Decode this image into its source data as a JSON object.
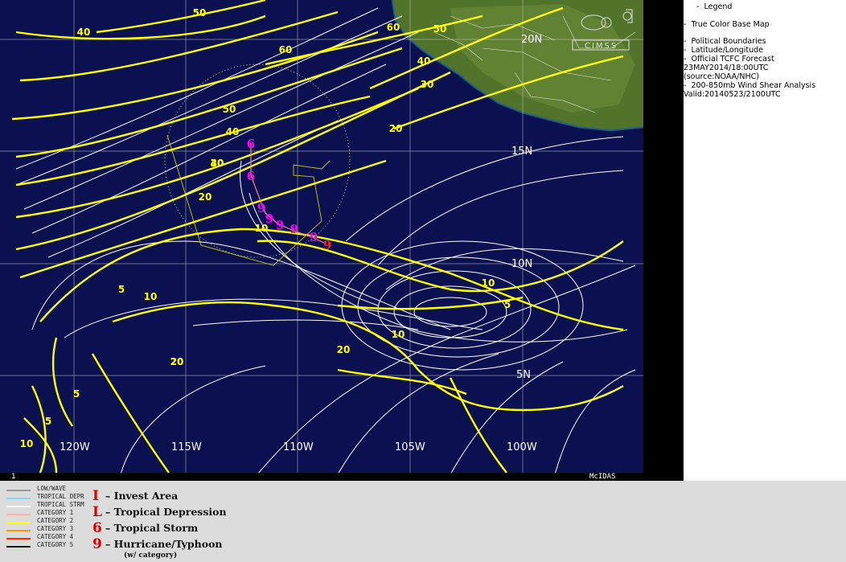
{
  "legend": {
    "title": "Legend",
    "lines": [
      "-  True Color Base Map",
      "",
      "-  Political Boundaries",
      "-  Latitude/Longitude",
      "-  Official TCFC Forecast",
      "23MAY2014/18:00UTC",
      "(source:NOAA/NHC)",
      "-  200-850mb Wind Shear Analysis",
      "Valid:20140523/2100UTC"
    ]
  },
  "map": {
    "lat_labels": [
      "20N",
      "15N",
      "10N",
      "5N"
    ],
    "lon_labels": [
      "120W",
      "115W",
      "110W",
      "105W",
      "100W"
    ],
    "contour_labels": [
      "50",
      "40",
      "60",
      "50",
      "40",
      "30",
      "60",
      "40",
      "30",
      "20",
      "50",
      "40",
      "30",
      "20",
      "10",
      "10",
      "5",
      "10",
      "5",
      "20",
      "20",
      "10",
      "20",
      "5",
      "5",
      "10"
    ],
    "frame_number": "1",
    "software": "McIDAS",
    "logo_text": "CIMSS",
    "track_symbols": [
      "storm",
      "storm",
      "hurricane",
      "hurricane",
      "hurricane",
      "hurricane",
      "hurricane",
      "hurricane"
    ]
  },
  "bottom_legend": {
    "categories": [
      {
        "label": "LOW/WAVE",
        "color": "#9a9a9a"
      },
      {
        "label": "TROPICAL DEPR",
        "color": "#7fd9ff"
      },
      {
        "label": "TROPICAL STRM",
        "color": "#ffffff"
      },
      {
        "label": "CATEGORY 1",
        "color": "#ffb3a0"
      },
      {
        "label": "CATEGORY 2",
        "color": "#ffff00"
      },
      {
        "label": "CATEGORY 3",
        "color": "#ff9a00"
      },
      {
        "label": "CATEGORY 4",
        "color": "#ff2a00"
      },
      {
        "label": "CATEGORY 5",
        "color": "#111111"
      }
    ],
    "symbols": [
      {
        "glyph": "I",
        "label": "– Invest Area"
      },
      {
        "glyph": "L",
        "label": "– Tropical Depression"
      },
      {
        "glyph": "6",
        "label": "– Tropical Storm"
      },
      {
        "glyph": "9",
        "label": "– Hurricane/Typhoon"
      }
    ],
    "symbols_note": "(w/ category)"
  },
  "colors": {
    "ocean": "#0b1150",
    "land": "#5b7a2a",
    "shear_contour": "#ffff00",
    "streamline": "#ffffff",
    "track": "#ff00ff",
    "forecast_point": "#ff0000"
  }
}
